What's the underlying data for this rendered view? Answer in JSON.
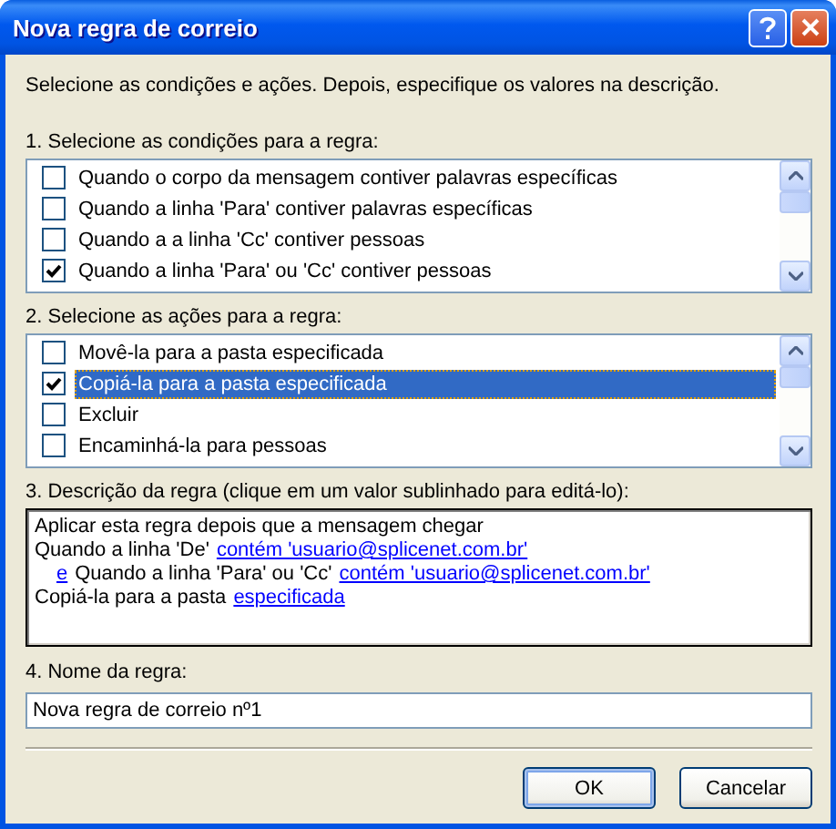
{
  "window": {
    "title": "Nova regra de correio"
  },
  "intro": "Selecione as condições e ações. Depois, especifique os valores na descrição.",
  "conditions": {
    "label": "1. Selecione as condições para a regra:",
    "items": [
      {
        "text": "Quando o corpo da mensagem contiver palavras específicas",
        "checked": false,
        "selected": false
      },
      {
        "text": "Quando a linha 'Para' contiver palavras específicas",
        "checked": false,
        "selected": false
      },
      {
        "text": "Quando a a linha 'Cc' contiver pessoas",
        "checked": false,
        "selected": false
      },
      {
        "text": "Quando a linha 'Para' ou 'Cc' contiver pessoas",
        "checked": true,
        "selected": false
      }
    ]
  },
  "actions": {
    "label": "2. Selecione as ações para a regra:",
    "items": [
      {
        "text": "Movê-la para a pasta especificada",
        "checked": false,
        "selected": false
      },
      {
        "text": "Copiá-la para a pasta especificada",
        "checked": true,
        "selected": true
      },
      {
        "text": "Excluir",
        "checked": false,
        "selected": false
      },
      {
        "text": "Encaminhá-la para pessoas",
        "checked": false,
        "selected": false
      }
    ]
  },
  "description": {
    "label": "3. Descrição da regra (clique em um valor sublinhado para editá-lo):",
    "lines": [
      {
        "indented": false,
        "segments": [
          {
            "kind": "text",
            "text": "Aplicar esta regra depois que a mensagem chegar"
          }
        ]
      },
      {
        "indented": false,
        "segments": [
          {
            "kind": "text",
            "text": "Quando a linha 'De'"
          },
          {
            "kind": "link",
            "text": "contém 'usuario@splicenet.com.br'"
          }
        ]
      },
      {
        "indented": true,
        "segments": [
          {
            "kind": "link",
            "text": "e"
          },
          {
            "kind": "text",
            "text": "Quando a linha 'Para' ou 'Cc'"
          },
          {
            "kind": "link",
            "text": "contém 'usuario@splicenet.com.br'"
          }
        ]
      },
      {
        "indented": false,
        "segments": [
          {
            "kind": "text",
            "text": "Copiá-la para a pasta"
          },
          {
            "kind": "link",
            "text": "especificada"
          }
        ]
      }
    ]
  },
  "name": {
    "label": "4. Nome da regra:",
    "value": "Nova regra de correio nº1"
  },
  "buttons": [
    {
      "label": "OK",
      "default": true
    },
    {
      "label": "Cancelar",
      "default": false
    }
  ]
}
